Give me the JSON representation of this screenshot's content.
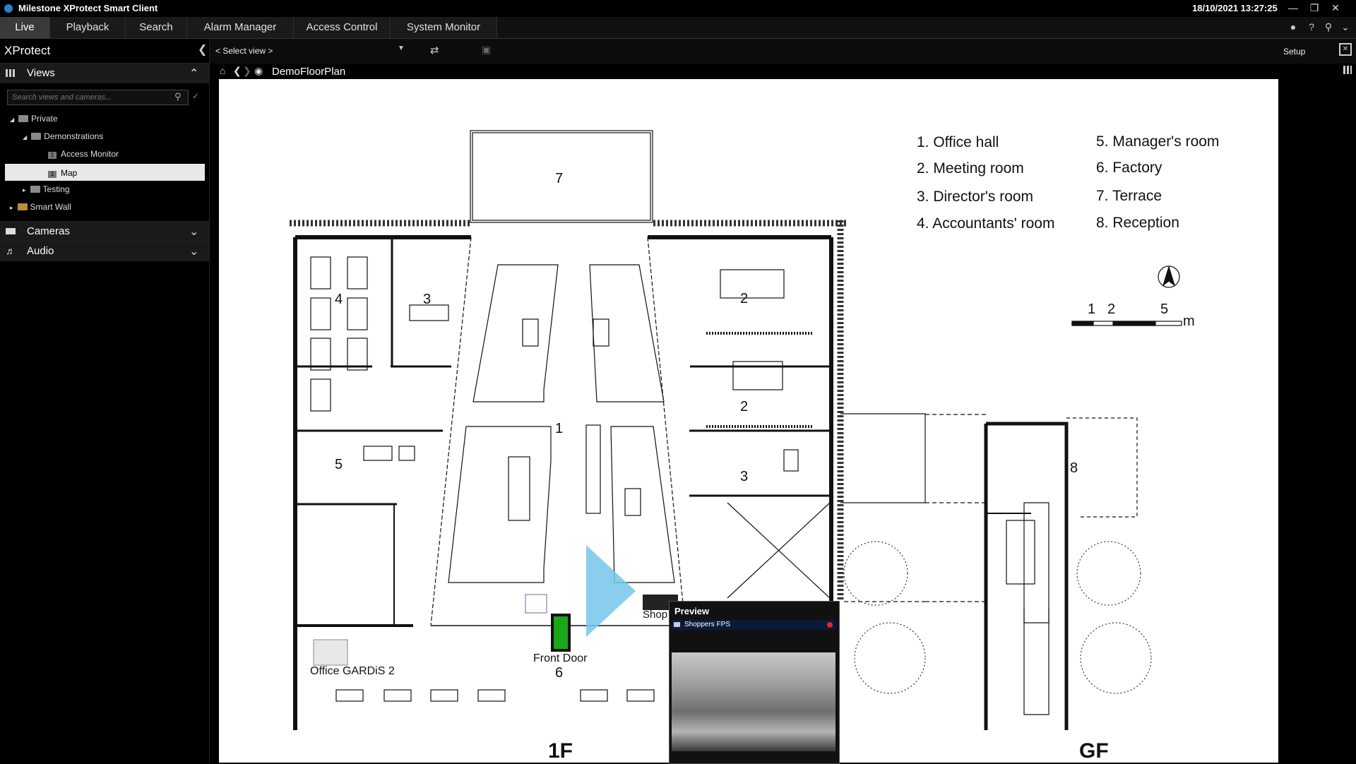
{
  "app": {
    "title": "Milestone XProtect Smart Client",
    "datetime": "18/10/2021 13:27:25"
  },
  "nav": {
    "tabs": [
      "Live",
      "Playback",
      "Search",
      "Alarm Manager",
      "Access Control",
      "System Monitor"
    ]
  },
  "toolbar": {
    "select_view": "< Select view >",
    "setup": "Setup"
  },
  "left": {
    "product": "XProtect",
    "views_header": "Views",
    "search_placeholder": "Search views and cameras...",
    "tree": {
      "private": "Private",
      "demonstrations": "Demonstrations",
      "access_monitor": "Access Monitor",
      "map": "Map",
      "testing": "Testing",
      "smart_wall": "Smart Wall"
    },
    "cameras_header": "Cameras",
    "audio_header": "Audio"
  },
  "breadcrumb": {
    "current": "DemoFloorPlan"
  },
  "map": {
    "legend_left": [
      "1.  Office hall",
      "2.  Meeting room",
      "3.  Director's room",
      "4.  Accountants' room"
    ],
    "legend_right": [
      "5.  Manager's room",
      "6.  Factory",
      "7.  Terrace",
      "8.  Reception"
    ],
    "scale": {
      "t1": "1",
      "t2": "2",
      "t5": "5",
      "unit": "m"
    },
    "rooms": {
      "r1": "1",
      "r2a": "2",
      "r2b": "2",
      "r3a": "3",
      "r3b": "3",
      "r4": "4",
      "r5": "5",
      "r6": "6",
      "r7": "7",
      "r8": "8"
    },
    "floors": {
      "first": "1F",
      "ground": "GF"
    },
    "labels": {
      "front_door": "Front Door",
      "office_gardis": "Office GARDiS 2",
      "shop": "Shop"
    }
  },
  "preview": {
    "title": "Preview",
    "camera": "Shoppers FPS"
  }
}
